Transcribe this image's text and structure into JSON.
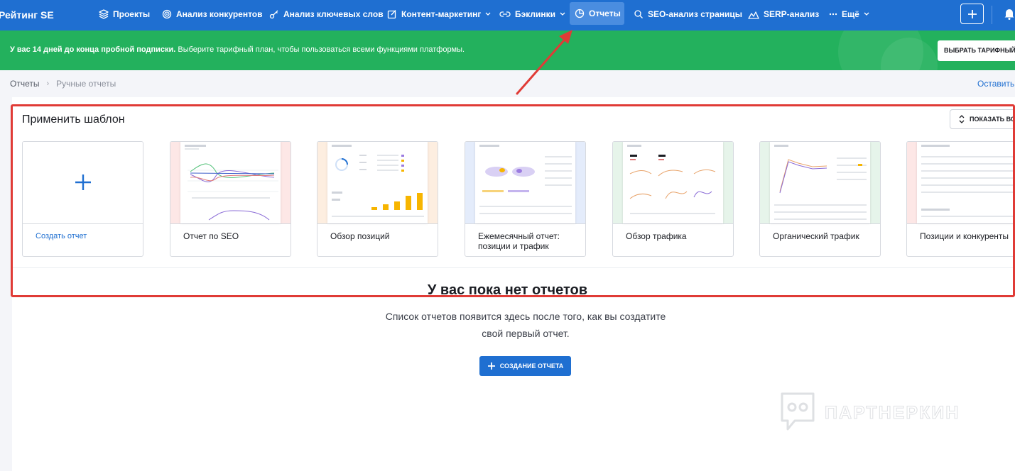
{
  "nav": {
    "brand": "Рейтинг SE",
    "items": [
      {
        "label": "Проекты",
        "icon": "layers-icon"
      },
      {
        "label": "Анализ конкурентов",
        "icon": "target-icon"
      },
      {
        "label": "Анализ ключевых слов",
        "icon": "key-icon"
      },
      {
        "label": "Контент-маркетинг",
        "icon": "edit-icon"
      },
      {
        "label": "Бэклинки",
        "icon": "link-icon"
      },
      {
        "label": "Отчеты",
        "icon": "pie-chart-icon",
        "active": true
      },
      {
        "label": "SEO-анализ страницы",
        "icon": "search-icon"
      },
      {
        "label": "SERP-анализ",
        "icon": "mountain-chart-icon"
      },
      {
        "label": "Ещё",
        "icon": "more-icon"
      }
    ]
  },
  "promo": {
    "bold": "У вас 14 дней до конца пробной подписки.",
    "text": " Выберите тарифный план, чтобы пользоваться всеми функциями платформы.",
    "button": "ВЫБРАТЬ ТАРИФНЫЙ ПЛАН"
  },
  "breadcrumb": {
    "root": "Отчеты",
    "current": "Ручные отчеты",
    "right_link": "Оставить отзыв"
  },
  "templates": {
    "title": "Применить шаблон",
    "show_button": "ПОКАЗАТЬ ВСЕ",
    "cards": [
      {
        "label": "Создать отчет"
      },
      {
        "label": "Отчет по SEO"
      },
      {
        "label": "Обзор позиций"
      },
      {
        "label": "Ежемесячный отчет: позиции и трафик"
      },
      {
        "label": "Обзор трафика"
      },
      {
        "label": "Органический трафик"
      },
      {
        "label": "Позиции и конкуренты"
      }
    ]
  },
  "empty": {
    "title": "У вас пока нет отчетов",
    "description": "Список отчетов появится здесь после того, как вы создатите свой первый отчет.",
    "button": "СОЗДАНИЕ ОТЧЕТА"
  },
  "watermark": "ПАРТНЕРКИН",
  "colors": {
    "nav": "#1f6fd1",
    "promo": "#23b15d",
    "annotation": "#e03b36"
  }
}
